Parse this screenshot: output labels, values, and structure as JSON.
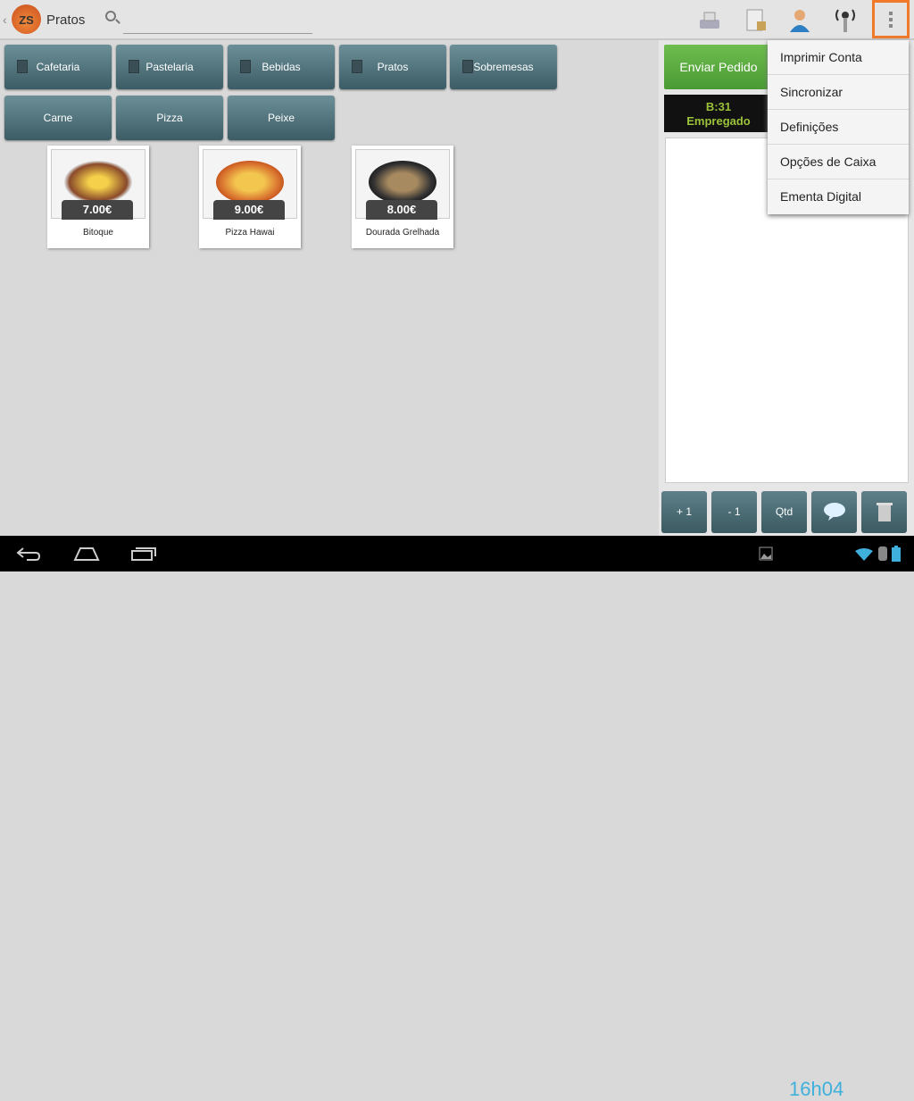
{
  "app": {
    "title": "Pratos",
    "logo_text": "ZS",
    "search_placeholder": ""
  },
  "toolbar": {
    "icons": [
      "cash-register-icon",
      "report-icon",
      "user-icon",
      "wireless-icon",
      "overflow-menu-icon"
    ]
  },
  "categories": [
    {
      "label": "Cafetaria",
      "icon": "list-icon"
    },
    {
      "label": "Pastelaria",
      "icon": "list-icon"
    },
    {
      "label": "Bebidas",
      "icon": "copy-icon"
    },
    {
      "label": "Pratos",
      "icon": "copy-icon"
    },
    {
      "label": "Sobremesas",
      "icon": "list-icon"
    },
    {
      "label": "Carne"
    },
    {
      "label": "Pizza"
    },
    {
      "label": "Peixe"
    }
  ],
  "products": [
    {
      "name": "Bitoque",
      "price": "7.00€"
    },
    {
      "name": "Pizza Hawai",
      "price": "9.00€"
    },
    {
      "name": "Dourada Grelhada",
      "price": "8.00€"
    }
  ],
  "order": {
    "send_label": "Enviar Pedido",
    "table": "B:31",
    "employee": "Empregado"
  },
  "menu": [
    "Imprimir Conta",
    "Sincronizar",
    "Definições",
    "Opções de Caixa",
    "Ementa Digital"
  ],
  "actions": {
    "plus": "+ 1",
    "minus": "- 1",
    "qty": "Qtd"
  },
  "status": {
    "time": "16h04"
  },
  "colors": {
    "accent": "#f07a2a",
    "send": "#5aaa40",
    "clock": "#3fb0dc"
  }
}
